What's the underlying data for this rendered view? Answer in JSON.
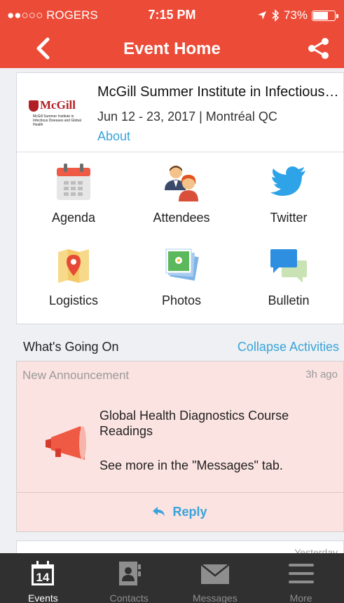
{
  "status_bar": {
    "carrier": "●●○○○ ROGERS",
    "time": "7:15 PM",
    "battery": "73%",
    "battery_level": 0.73
  },
  "nav": {
    "title": "Event Home",
    "back_icon": "chevron-left-icon",
    "share_icon": "share-icon"
  },
  "event": {
    "logo_name": "McGill",
    "logo_subtext": "McGill Summer Institute in Infectious Diseases and Global Health",
    "title": "McGill Summer Institute in Infectious Diseases and Global Health",
    "dates": "Jun 12 - 23, 2017 | Montréal QC",
    "about_label": "About"
  },
  "tiles": [
    {
      "label": "Agenda",
      "icon": "calendar-icon"
    },
    {
      "label": "Attendees",
      "icon": "people-icon"
    },
    {
      "label": "Twitter",
      "icon": "twitter-icon"
    },
    {
      "label": "Logistics",
      "icon": "map-pin-icon"
    },
    {
      "label": "Photos",
      "icon": "photos-icon"
    },
    {
      "label": "Bulletin",
      "icon": "chat-bubbles-icon"
    }
  ],
  "activities": {
    "heading": "What's Going On",
    "collapse_label": "Collapse Activities",
    "announcement": {
      "type": "New Announcement",
      "time_ago": "3h ago",
      "title": "Global Health Diagnostics Course Readings",
      "subtitle": "See more in the \"Messages\" tab.",
      "reply_label": "Reply"
    },
    "next_time_ago": "Yesterday"
  },
  "tabbar": [
    {
      "label": "Events",
      "icon": "calendar-14-icon",
      "active": true
    },
    {
      "label": "Contacts",
      "icon": "contacts-icon",
      "active": false
    },
    {
      "label": "Messages",
      "icon": "envelope-icon",
      "active": false
    },
    {
      "label": "More",
      "icon": "menu-icon",
      "active": false
    }
  ],
  "colors": {
    "brand": "#ec4b37",
    "link": "#3aa3da",
    "announcement_bg": "#fbe3e1",
    "tabbar_bg": "#303030"
  }
}
